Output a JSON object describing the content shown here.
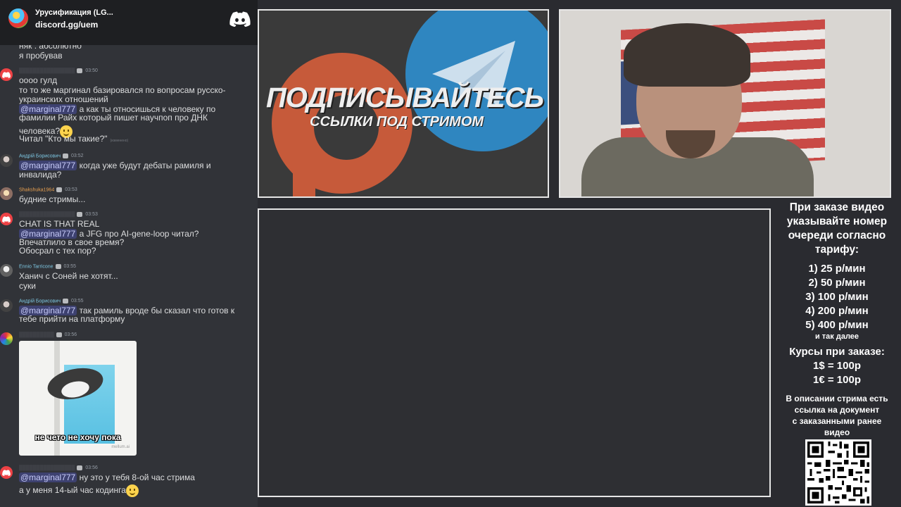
{
  "chat_header": {
    "server_name": "Урусификация (LG...",
    "invite": "discord.gg/uem"
  },
  "messages": [
    {
      "lines": [
        "няк . абсолютно",
        "я пробував"
      ]
    },
    {
      "time": "03:50",
      "lines": [
        "оооо гулд",
        "то то же маргинал базировался по вопросам русско-",
        "украинских отношений"
      ],
      "mention_line": {
        "mention": "@marginal777",
        "text": " а как ты относишься к человеку по"
      },
      "extra": [
        "фамилии Райх который пишет научпоп про ДНК",
        "человека?",
        "Читал  \"Кто мы такие?\""
      ],
      "edited": "(изменено)"
    },
    {
      "author": "Андрій Борисович",
      "time": "03:52",
      "mention": "@marginal777",
      "text": " когда уже будут дебаты рамиля и",
      "cont": "инвалида?"
    },
    {
      "author": "Shakshuka1964",
      "time": "03:53",
      "lines": [
        "будние стримы..."
      ]
    },
    {
      "time": "03:53",
      "lines": [
        "CHAT IS THAT REAL"
      ],
      "mention": "@marginal777",
      "text": "  а JFG про AI-gene-loop читал?",
      "cont": [
        "Впечатлило в свое время?",
        "Обосрал с тех пор?"
      ]
    },
    {
      "author": "Ennio Tarricone",
      "time": "03:55",
      "lines": [
        "Ханич с Соней не хотят...",
        "суки"
      ]
    },
    {
      "author": "Андрій Борисович",
      "time": "03:55",
      "mention": "@marginal777",
      "text": " так рамиль вроде бы сказал что готов к",
      "cont": "тебе прийти на платформу"
    },
    {
      "time": "03:56",
      "image_caption": "не чето не хочу пока",
      "image_watermark": "mellum.ai"
    },
    {
      "time": "03:56",
      "mention": "@marginal777",
      "text": " ну это у тебя 8-ой час стрима",
      "cont": "а у меня 14-ый час кодинга"
    }
  ],
  "banner": {
    "title": "ПОДПИСЫВАЙТЕСЬ",
    "subtitle": "ССЫЛКИ ПОД СТРИМОМ"
  },
  "info": {
    "heading": [
      "При заказе видео",
      "указывайте номер",
      "очереди согласно",
      "тарифу:"
    ],
    "tiers": [
      "1) 25 р/мин",
      "2) 50 р/мин",
      "3) 100 р/мин",
      "4) 200 р/мин",
      "5) 400 р/мин"
    ],
    "and_so_on": "и так далее",
    "rates_heading": "Курсы при заказе:",
    "rates": [
      "1$ = 100р",
      "1€ = 100р"
    ],
    "description": [
      "В описании стрима есть",
      "ссылка на документ",
      "с заказанными ранее",
      "видео"
    ]
  },
  "colors": {
    "discord_red": "#ed4245",
    "telegram_blue": "#2f86c0",
    "patreon_orange": "#c65a3a",
    "mention_bg": "#3c4270"
  }
}
